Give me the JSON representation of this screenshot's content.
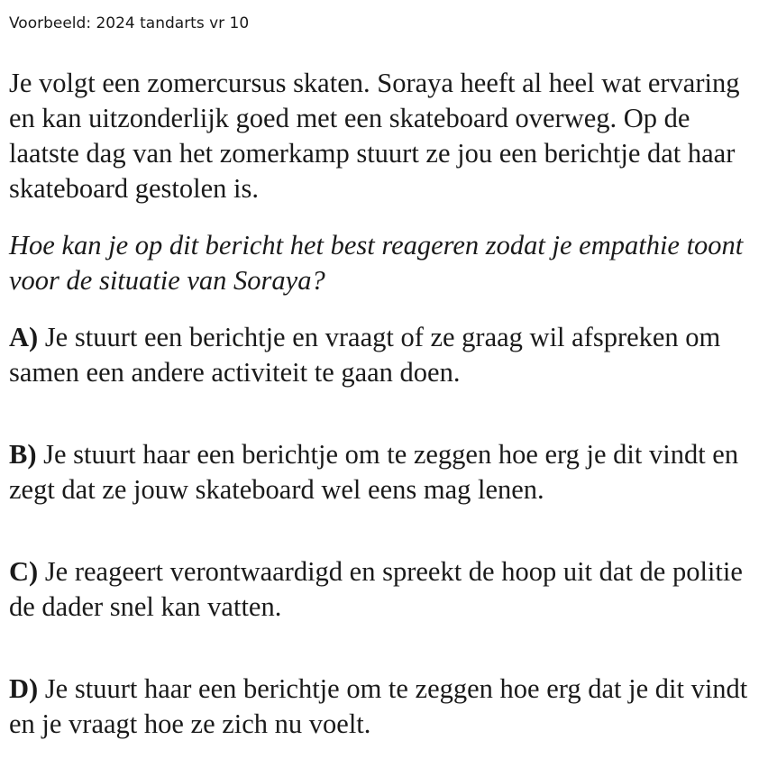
{
  "caption": "Voorbeeld: 2024 tandarts vr 10",
  "intro": "Je volgt een zomercursus skaten. Soraya heeft al heel wat ervaring en kan uitzonderlijk goed met een skateboard overweg. Op de laatste dag van het zomerkamp stuurt ze jou een berichtje dat haar skateboard gestolen is.",
  "question": "Hoe kan je op dit bericht het best reageren zodat je empathie toont voor de situatie van Soraya?",
  "options": [
    {
      "letter": "A)",
      "text": "Je stuurt een berichtje en vraagt of ze graag wil afspreken om samen een andere activiteit te gaan doen."
    },
    {
      "letter": "B)",
      "text": "Je stuurt haar een berichtje om te zeggen hoe erg je dit vindt en zegt dat ze jouw skateboard wel eens mag lenen."
    },
    {
      "letter": "C)",
      "text": "Je reageert verontwaardigd en spreekt de hoop uit dat de politie de dader snel kan vatten."
    },
    {
      "letter": "D)",
      "text": "Je stuurt haar een berichtje om te zeggen hoe erg dat je dit vindt en je vraagt hoe ze zich nu voelt."
    }
  ]
}
